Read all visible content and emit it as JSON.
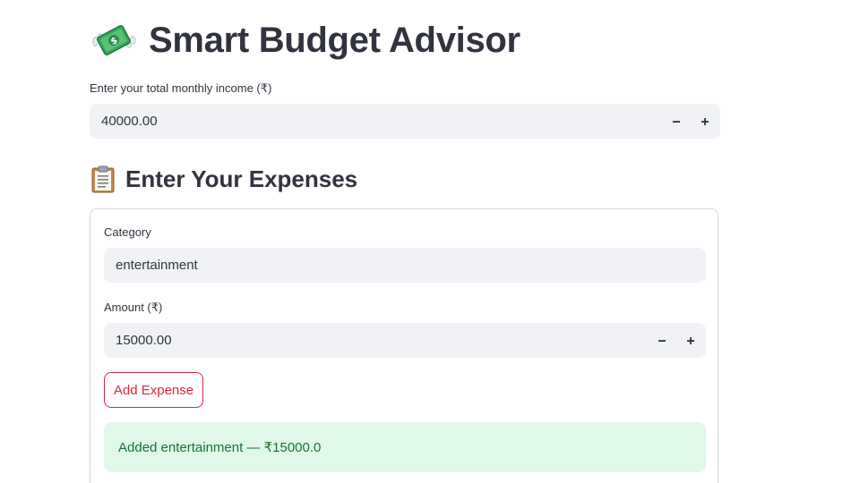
{
  "app": {
    "title": "Smart Budget Advisor",
    "title_icon": "money-with-wings-icon"
  },
  "income": {
    "label": "Enter your total monthly income (₹)",
    "value": "40000.00",
    "decrement": "−",
    "increment": "+"
  },
  "expenses": {
    "heading": "Enter Your Expenses",
    "heading_icon": "clipboard-icon",
    "category_label": "Category",
    "category_value": "entertainment",
    "amount_label": "Amount (₹)",
    "amount_value": "15000.00",
    "decrement": "−",
    "increment": "+",
    "add_button": "Add Expense",
    "success_message": "Added entertainment — ₹15000.0"
  },
  "colors": {
    "accent": "#e0263b",
    "input_bg": "#f0f2f6",
    "success_bg": "#dff8e8",
    "success_text": "#177233",
    "text": "#31333f"
  }
}
